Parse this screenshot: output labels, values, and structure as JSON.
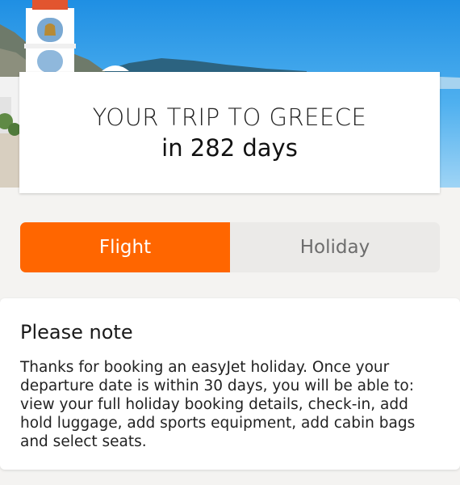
{
  "hero": {
    "image": "greek-island-church-bell-tower",
    "trip_title": "YOUR TRIP TO GREECE",
    "countdown": "in 282 days"
  },
  "tabs": [
    {
      "label": "Flight",
      "active": true
    },
    {
      "label": "Holiday",
      "active": false
    }
  ],
  "note": {
    "heading": "Please note",
    "body": "Thanks for booking an easyJet holiday. Once your departure date is within 30 days, you will be able to: view your full holiday booking details, check-in, add hold luggage, add sports equipment, add cabin bags and select seats."
  },
  "colors": {
    "accent": "#ff6600",
    "tab_inactive_bg": "#ebeae8",
    "page_bg": "#f4f3f1"
  }
}
